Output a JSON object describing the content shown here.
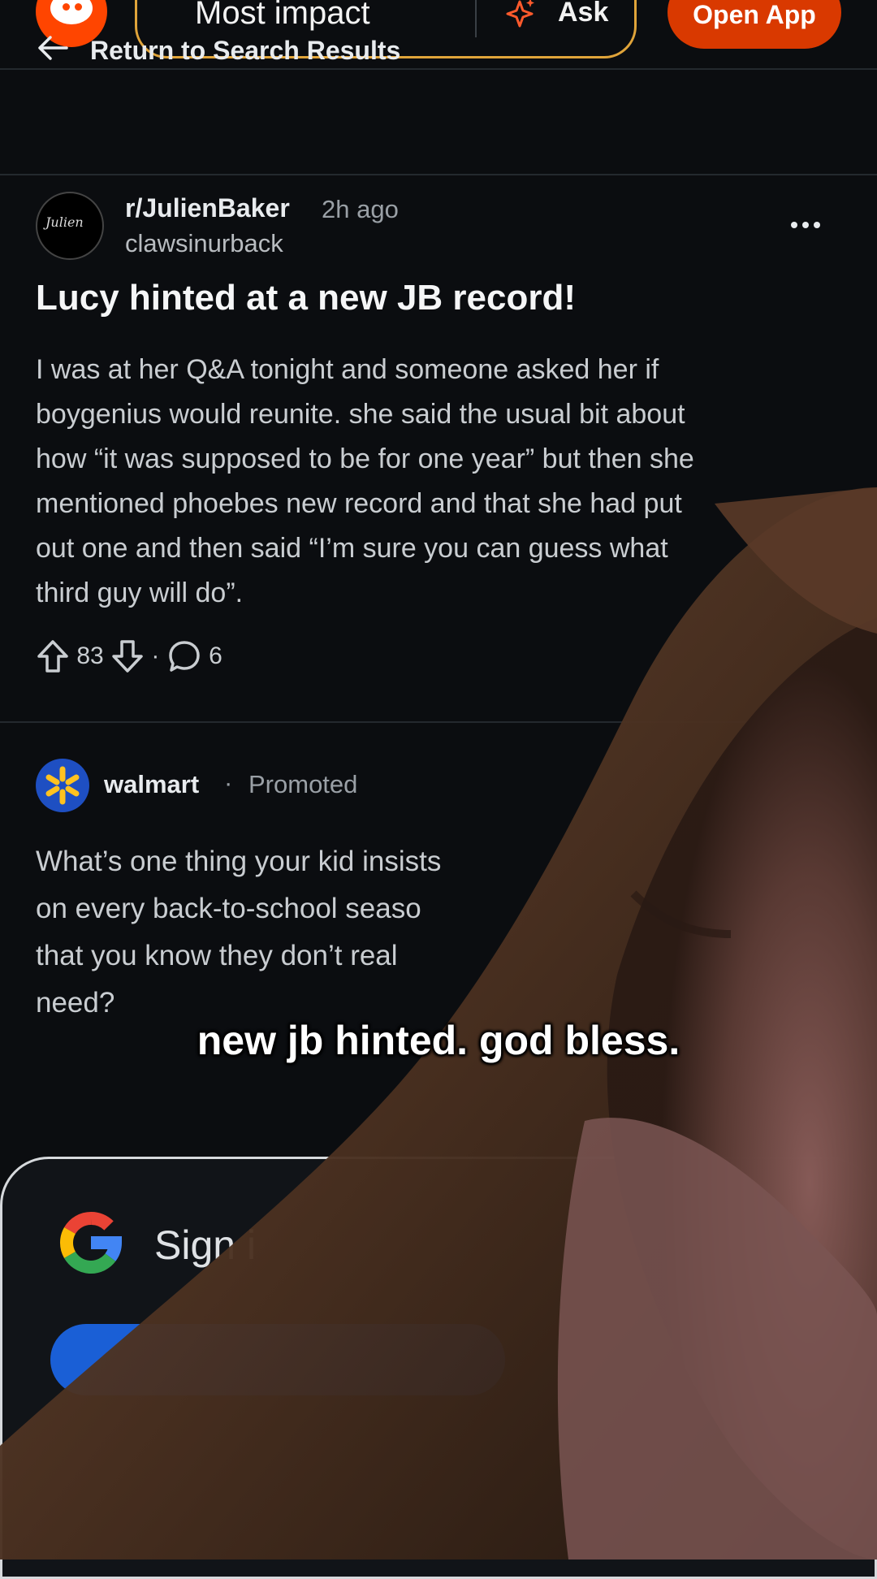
{
  "topbar": {
    "search_text": "Most impact",
    "ask_label": "Ask",
    "open_app_label": "Open App"
  },
  "nav": {
    "back_label": "Return to Search Results"
  },
  "post": {
    "subreddit": "r/JulienBaker",
    "time": "2h ago",
    "author": "clawsinurback",
    "title": "Lucy hinted at a new JB record!",
    "body_lines": [
      "I was at her Q&A tonight and someone asked her if",
      "boygenius would reunite. she said the usual bit about",
      "how “it was supposed to be for one year” but then she",
      "mentioned phoebes new record and that she had put",
      "out one and then said “I’m sure you can guess what",
      "third guy will do”."
    ],
    "upvotes": "83",
    "separator": "·",
    "comments": "6"
  },
  "ad": {
    "advertiser": "walmart",
    "dot": "·",
    "promoted_label": "Promoted",
    "text_lines": [
      "What’s one thing your kid insists",
      "on every back-to-school seaso",
      "that you know they don’t real",
      "need?"
    ]
  },
  "signin": {
    "label": "Sign i"
  },
  "overlay": {
    "caption": "new jb hinted. god bless."
  },
  "colors": {
    "brand_orange": "#ff4500",
    "open_app_bg": "#d93900",
    "search_border": "#e0a43a",
    "walmart_blue": "#1e4fc2",
    "walmart_yellow": "#ffc220",
    "google_button": "#1a5fd6"
  },
  "icons": {
    "logo": "reddit-logo-icon",
    "ask": "sparkle-icon",
    "back": "arrow-left-icon",
    "more": "more-horizontal-icon",
    "upvote": "arrow-up-icon",
    "downvote": "arrow-down-icon",
    "comment": "comment-bubble-icon",
    "google": "google-icon",
    "walmart": "walmart-spark-icon"
  }
}
